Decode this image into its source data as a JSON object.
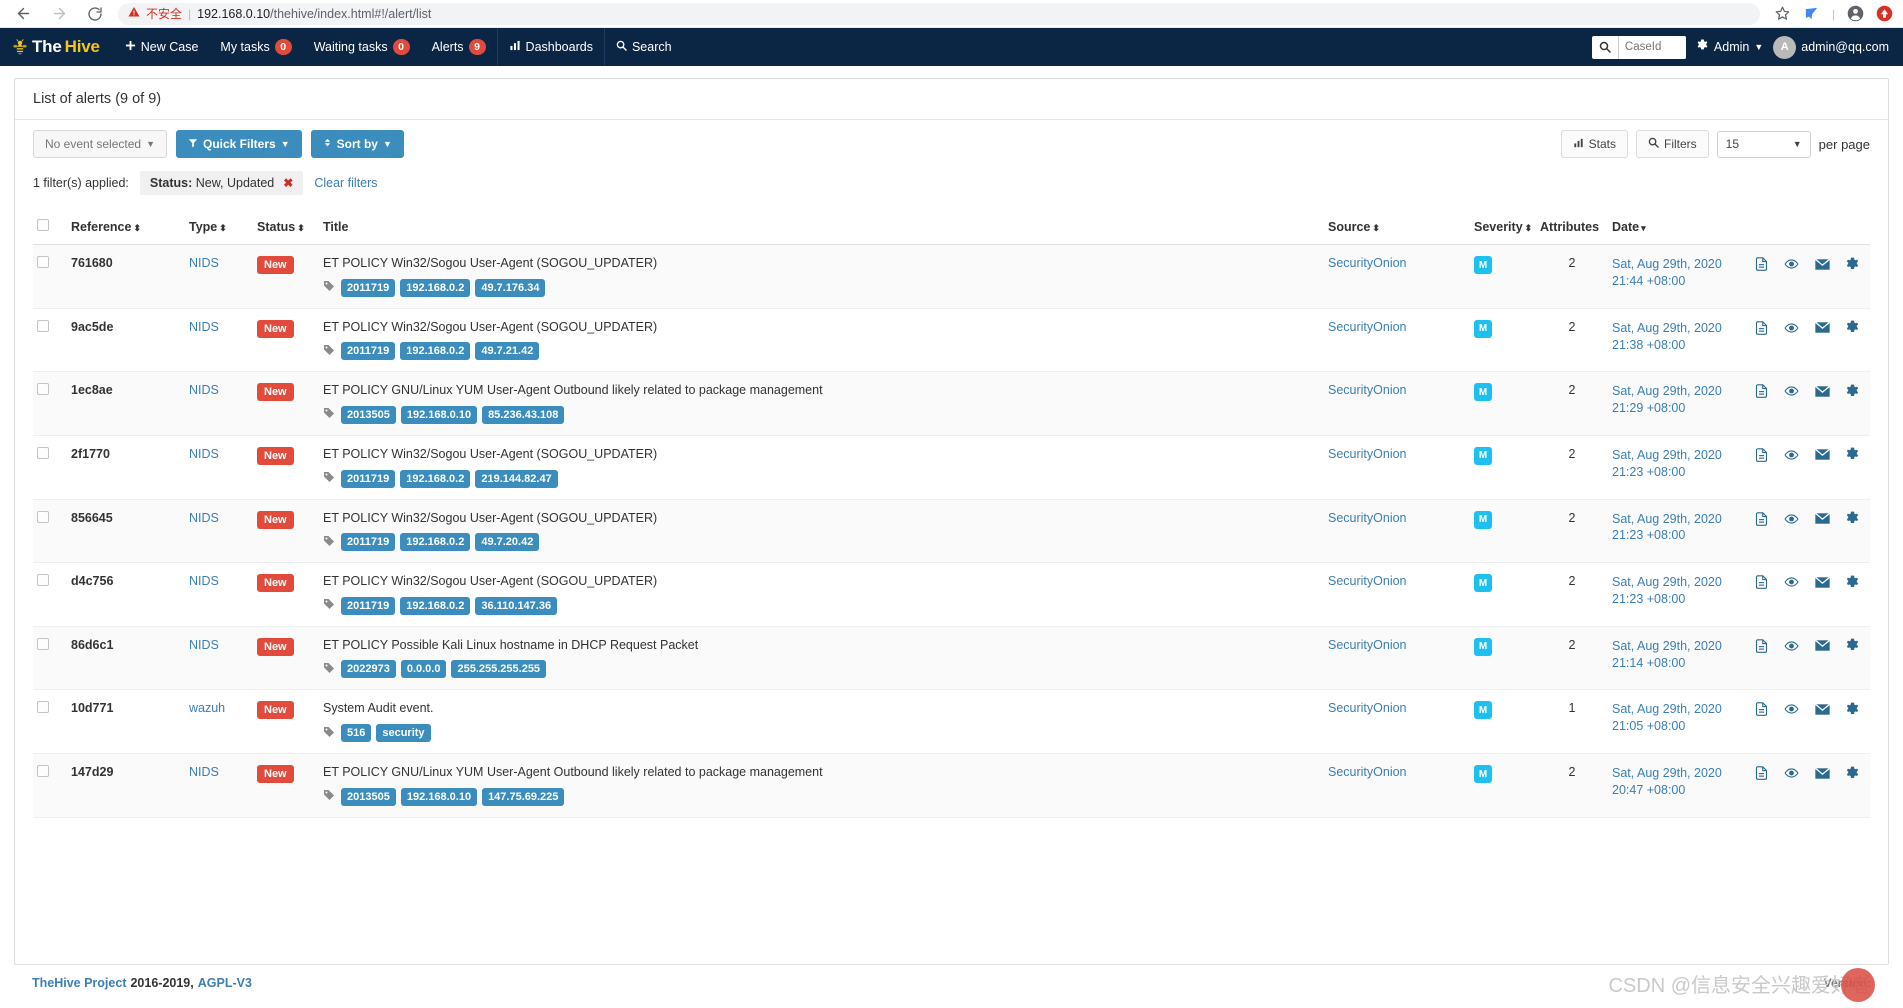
{
  "browser": {
    "back_icon": "back-arrow-icon",
    "forward_icon": "forward-arrow-icon",
    "reload_icon": "reload-icon",
    "security_warning": "不安全",
    "url_host": "192.168.0.10",
    "url_path": "/thehive/index.html#!/alert/list",
    "star_icon": "bookmark-star-icon",
    "extension_icon": "extension-icon",
    "profile_icon": "profile-icon",
    "update_icon": "update-icon"
  },
  "navbar": {
    "brand_the": "The",
    "brand_hive": "Hive",
    "items": [
      {
        "label": "New Case",
        "icon": "plus-icon",
        "badge": null
      },
      {
        "label": "My tasks",
        "icon": null,
        "badge": "0"
      },
      {
        "label": "Waiting tasks",
        "icon": null,
        "badge": "0"
      },
      {
        "label": "Alerts",
        "icon": null,
        "badge": "9"
      },
      {
        "label": "Dashboards",
        "icon": "chart-bar-icon",
        "badge": null
      },
      {
        "label": "Search",
        "icon": "search-icon",
        "badge": null
      }
    ],
    "search_placeholder": "CaseId",
    "admin_label": "Admin",
    "user_initial": "A",
    "user_email": "admin@qq.com"
  },
  "panel": {
    "title": "List of alerts (9 of 9)",
    "toolbar": {
      "event_select_label": "No event selected",
      "quick_filters_label": "Quick Filters",
      "sort_by_label": "Sort by",
      "stats_label": "Stats",
      "filters_label": "Filters",
      "per_page_value": "15",
      "per_page_label": "per page"
    },
    "filters": {
      "applied_text": "1 filter(s) applied:",
      "chip_key": "Status:",
      "chip_value": "New, Updated",
      "clear_label": "Clear filters"
    }
  },
  "table": {
    "columns": [
      {
        "key": "select",
        "label": ""
      },
      {
        "key": "reference",
        "label": "Reference",
        "sortable": true
      },
      {
        "key": "type",
        "label": "Type",
        "sortable": true
      },
      {
        "key": "status",
        "label": "Status",
        "sortable": true
      },
      {
        "key": "title",
        "label": "Title",
        "sortable": false
      },
      {
        "key": "source",
        "label": "Source",
        "sortable": true
      },
      {
        "key": "severity",
        "label": "Severity",
        "sortable": true
      },
      {
        "key": "attributes",
        "label": "Attributes",
        "sortable": false
      },
      {
        "key": "date",
        "label": "Date",
        "sortable": true,
        "sorted": "desc"
      },
      {
        "key": "actions",
        "label": ""
      }
    ],
    "row_actions": [
      "document-icon",
      "eye-icon",
      "envelope-icon",
      "gear-icon"
    ],
    "rows": [
      {
        "reference": "761680",
        "type": "NIDS",
        "status": "New",
        "title": "ET POLICY Win32/Sogou User-Agent (SOGOU_UPDATER)",
        "tags": [
          "2011719",
          "192.168.0.2",
          "49.7.176.34"
        ],
        "source": "SecurityOnion",
        "severity": "M",
        "attributes": "2",
        "date_line1": "Sat, Aug 29th, 2020",
        "date_line2": "21:44 +08:00"
      },
      {
        "reference": "9ac5de",
        "type": "NIDS",
        "status": "New",
        "title": "ET POLICY Win32/Sogou User-Agent (SOGOU_UPDATER)",
        "tags": [
          "2011719",
          "192.168.0.2",
          "49.7.21.42"
        ],
        "source": "SecurityOnion",
        "severity": "M",
        "attributes": "2",
        "date_line1": "Sat, Aug 29th, 2020",
        "date_line2": "21:38 +08:00"
      },
      {
        "reference": "1ec8ae",
        "type": "NIDS",
        "status": "New",
        "title": "ET POLICY GNU/Linux YUM User-Agent Outbound likely related to package management",
        "tags": [
          "2013505",
          "192.168.0.10",
          "85.236.43.108"
        ],
        "source": "SecurityOnion",
        "severity": "M",
        "attributes": "2",
        "date_line1": "Sat, Aug 29th, 2020",
        "date_line2": "21:29 +08:00"
      },
      {
        "reference": "2f1770",
        "type": "NIDS",
        "status": "New",
        "title": "ET POLICY Win32/Sogou User-Agent (SOGOU_UPDATER)",
        "tags": [
          "2011719",
          "192.168.0.2",
          "219.144.82.47"
        ],
        "source": "SecurityOnion",
        "severity": "M",
        "attributes": "2",
        "date_line1": "Sat, Aug 29th, 2020",
        "date_line2": "21:23 +08:00"
      },
      {
        "reference": "856645",
        "type": "NIDS",
        "status": "New",
        "title": "ET POLICY Win32/Sogou User-Agent (SOGOU_UPDATER)",
        "tags": [
          "2011719",
          "192.168.0.2",
          "49.7.20.42"
        ],
        "source": "SecurityOnion",
        "severity": "M",
        "attributes": "2",
        "date_line1": "Sat, Aug 29th, 2020",
        "date_line2": "21:23 +08:00"
      },
      {
        "reference": "d4c756",
        "type": "NIDS",
        "status": "New",
        "title": "ET POLICY Win32/Sogou User-Agent (SOGOU_UPDATER)",
        "tags": [
          "2011719",
          "192.168.0.2",
          "36.110.147.36"
        ],
        "source": "SecurityOnion",
        "severity": "M",
        "attributes": "2",
        "date_line1": "Sat, Aug 29th, 2020",
        "date_line2": "21:23 +08:00"
      },
      {
        "reference": "86d6c1",
        "type": "NIDS",
        "status": "New",
        "title": "ET POLICY Possible Kali Linux hostname in DHCP Request Packet",
        "tags": [
          "2022973",
          "0.0.0.0",
          "255.255.255.255"
        ],
        "source": "SecurityOnion",
        "severity": "M",
        "attributes": "2",
        "date_line1": "Sat, Aug 29th, 2020",
        "date_line2": "21:14 +08:00"
      },
      {
        "reference": "10d771",
        "type": "wazuh",
        "status": "New",
        "title": "System Audit event.",
        "tags": [
          "516",
          "security"
        ],
        "source": "SecurityOnion",
        "severity": "M",
        "attributes": "1",
        "date_line1": "Sat, Aug 29th, 2020",
        "date_line2": "21:05 +08:00"
      },
      {
        "reference": "147d29",
        "type": "NIDS",
        "status": "New",
        "title": "ET POLICY GNU/Linux YUM User-Agent Outbound likely related to package management",
        "tags": [
          "2013505",
          "192.168.0.10",
          "147.75.69.225"
        ],
        "source": "SecurityOnion",
        "severity": "M",
        "attributes": "2",
        "date_line1": "Sat, Aug 29th, 2020",
        "date_line2": "20:47 +08:00"
      }
    ]
  },
  "footer": {
    "project_link": "TheHive Project",
    "copyright": "2016-2019,",
    "license_link": "AGPL-V3",
    "version_label": "Version:",
    "watermark": "CSDN @信息安全兴趣爱好者"
  },
  "colors": {
    "navbar_bg": "#0b2545",
    "brand_accent": "#f5c518",
    "primary": "#3b8dbd",
    "danger": "#e24b3c",
    "severity_medium": "#1ec0ef",
    "link": "#3b7fb5"
  }
}
